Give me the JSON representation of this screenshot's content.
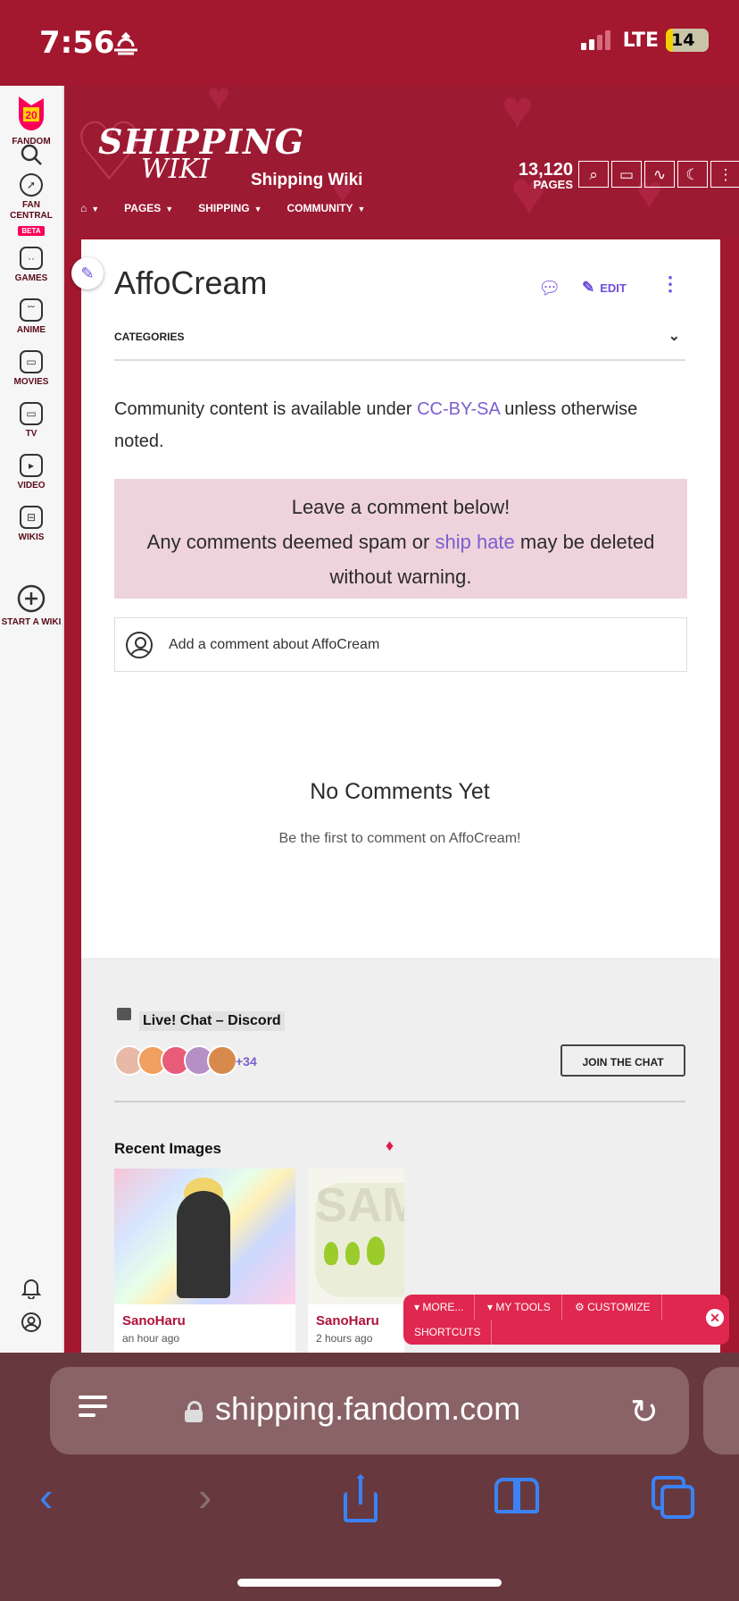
{
  "status_bar": {
    "time": "7:56",
    "network": "LTE",
    "battery": "14"
  },
  "fandom_rail": {
    "logo_badge": "20",
    "items": [
      {
        "label": "FANDOM"
      },
      {
        "label": "FAN CENTRAL",
        "badge": "BETA"
      },
      {
        "label": "GAMES"
      },
      {
        "label": "ANIME"
      },
      {
        "label": "MOVIES"
      },
      {
        "label": "TV"
      },
      {
        "label": "VIDEO"
      },
      {
        "label": "WIKIS"
      },
      {
        "label": "START A WIKI"
      }
    ]
  },
  "wiki_header": {
    "logo_line1": "SHIPPING",
    "logo_line2": "WIKI",
    "name": "Shipping Wiki",
    "page_count": "13,120",
    "page_count_label": "PAGES",
    "nav": [
      "PAGES",
      "SHIPPING",
      "COMMUNITY"
    ]
  },
  "article": {
    "title": "AffoCream",
    "edit_label": "EDIT",
    "categories_label": "CATEGORIES",
    "license_prefix": "Community content is available under ",
    "license_link": "CC-BY-SA",
    "license_suffix": " unless otherwise noted.",
    "notice_line1": "Leave a comment below!",
    "notice_prefix": "Any comments deemed spam or ",
    "notice_link": "ship hate",
    "notice_suffix": " may be deleted without warning.",
    "comment_placeholder": "Add a comment about AffoCream",
    "no_comments_title": "No Comments Yet",
    "no_comments_sub": "Be the first to comment on AffoCream!"
  },
  "discord": {
    "title": "Live! Chat – Discord",
    "extra_count": "+34",
    "join_label": "JOIN THE CHAT",
    "avatar_colors": [
      "#e8b9a6",
      "#f0a060",
      "#e85c7a",
      "#b58fc5",
      "#d88a4c"
    ]
  },
  "recent_images": {
    "title": "Recent Images",
    "items": [
      {
        "user": "SanoHaru",
        "time": "an hour ago"
      },
      {
        "user": "SanoHaru",
        "time": "2 hours ago"
      }
    ]
  },
  "tools_bar": {
    "more": "MORE...",
    "my_tools": "MY TOOLS",
    "customize": "CUSTOMIZE",
    "shortcuts": "SHORTCUTS"
  },
  "browser": {
    "url": "shipping.fandom.com"
  },
  "colors": {
    "brand": "#a3172f",
    "accent": "#7a5fcf",
    "tools": "#e0274f",
    "ios_blue": "#3b82f6"
  }
}
